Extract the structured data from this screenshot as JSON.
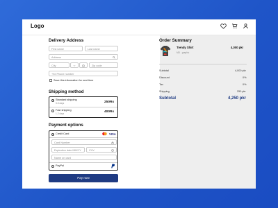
{
  "header": {
    "logo": "Logo"
  },
  "delivery": {
    "title": "Delivery Address",
    "first_name_placeholder": "First name",
    "last_name_placeholder": "Last name",
    "address_placeholder": "Address",
    "city_placeholder": "City",
    "zip_placeholder": "Zip code",
    "phone_placeholder": "+92  Phone number",
    "save_label": "Save this information for next time"
  },
  "shipping": {
    "title": "Shipping method",
    "options": [
      {
        "name": "Standard shipping",
        "eta": "3-5 days",
        "price": "250Rs",
        "selected": true
      },
      {
        "name": "Fast shipping",
        "eta": "1-2 days",
        "price": "400Rs",
        "selected": false
      }
    ]
  },
  "payment": {
    "title": "Payment options",
    "credit_label": "Credit Card",
    "card_number_placeholder": "Card Number",
    "expiry_placeholder": "Expiration date MM/YY",
    "cvv_placeholder": "CVV",
    "name_placeholder": "Name on card",
    "paypal_label": "PayPal",
    "visa": "VISA"
  },
  "cta": {
    "pay": "Pay now"
  },
  "summary": {
    "title": "Order Summary",
    "item": {
      "name": "Trendy Shirt",
      "variant": "MD - graphic",
      "price": "4,000 pkr"
    },
    "lines": [
      {
        "label": "Subtotal",
        "value": "4,000 pkr"
      },
      {
        "label": "Discount",
        "value": "0%"
      },
      {
        "label": "Tax",
        "value": "0%"
      },
      {
        "label": "Shipping",
        "value": "250 pkr"
      }
    ],
    "total_label": "Subtotal",
    "total_value": "4,250 pkr"
  },
  "colors": {
    "accent": "#1f3b83",
    "background": "#2f6bd9",
    "summary_panel": "#eeeeee"
  }
}
